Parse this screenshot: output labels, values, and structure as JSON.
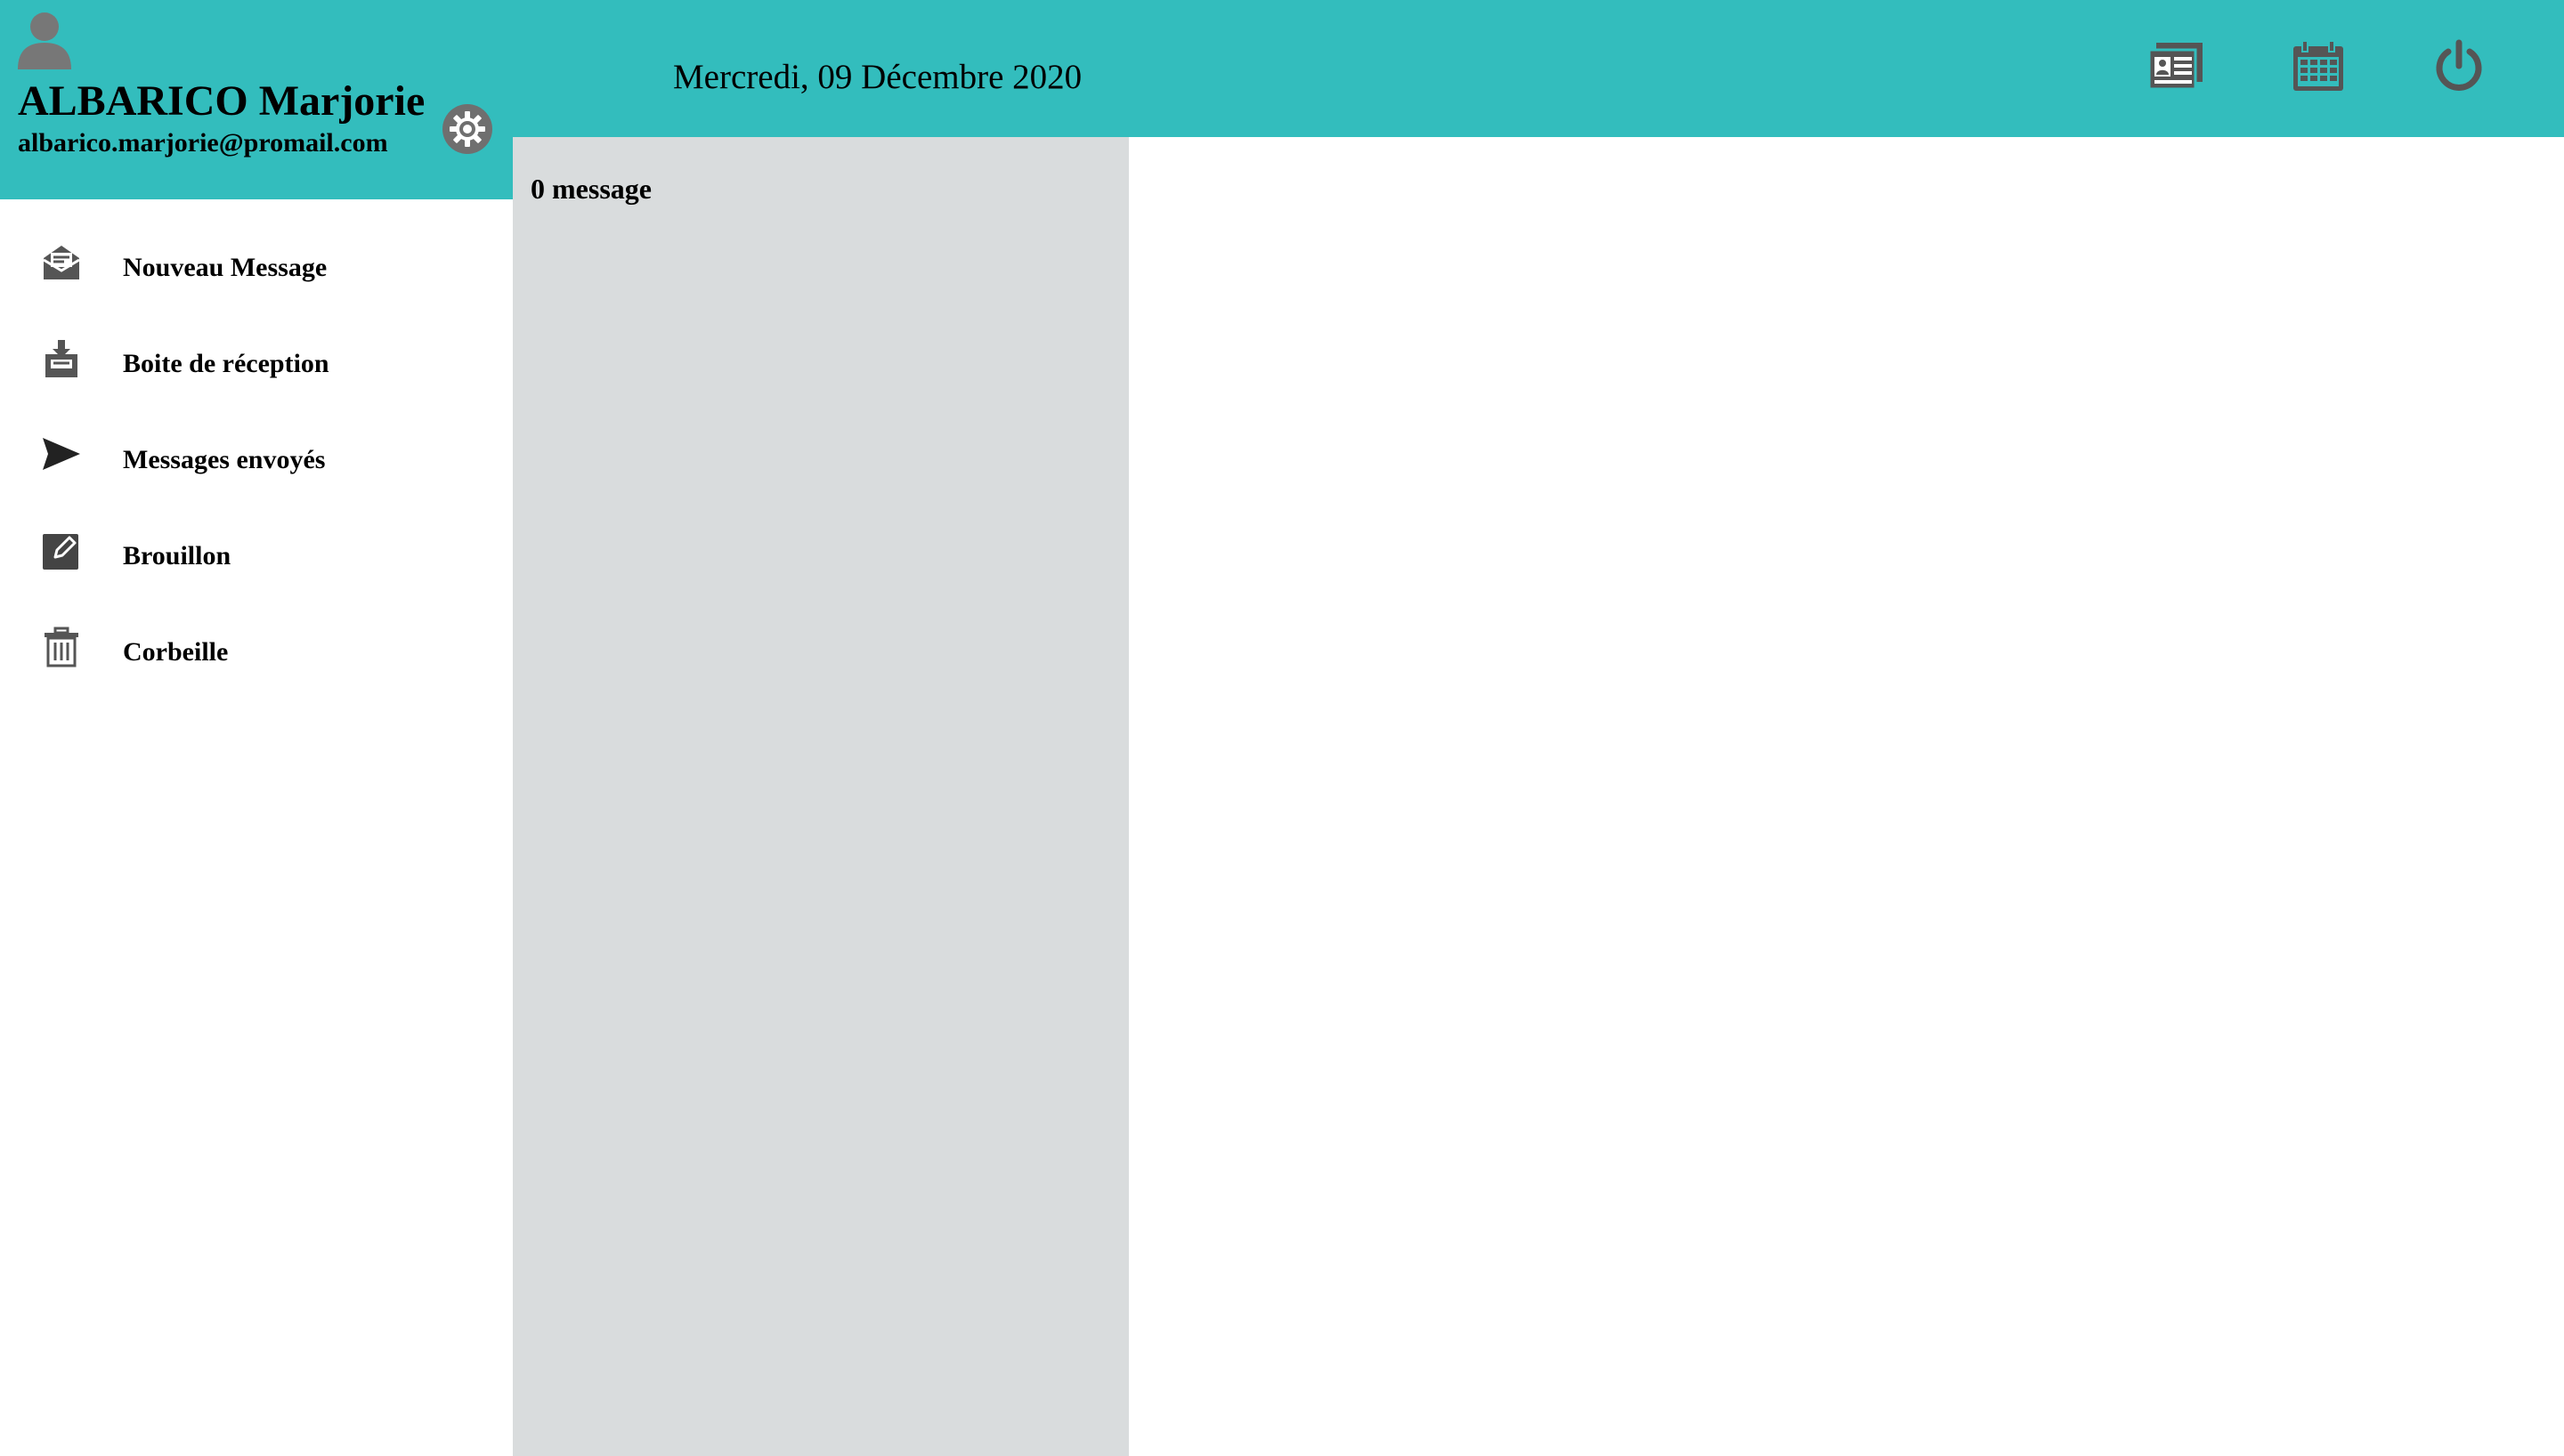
{
  "user": {
    "name": "ALBARICO Marjorie",
    "email": "albarico.marjorie@promail.com",
    "avatar_icon": "user-avatar-icon"
  },
  "header": {
    "date": "Mercredi, 09 Décembre 2020",
    "icons": [
      "contacts-card-icon",
      "calendar-icon",
      "power-icon"
    ]
  },
  "nav": {
    "items": [
      {
        "label": "Nouveau Message",
        "icon": "open-envelope-icon"
      },
      {
        "label": "Boite de réception",
        "icon": "inbox-tray-icon"
      },
      {
        "label": "Messages envoyés",
        "icon": "paper-plane-icon"
      },
      {
        "label": "Brouillon",
        "icon": "edit-square-icon"
      },
      {
        "label": "Corbeille",
        "icon": "trash-icon"
      }
    ]
  },
  "message_list": {
    "count_label": "0 message"
  },
  "colors": {
    "header_bg": "#33bdbd",
    "list_bg": "#d9dcdd",
    "icon_gray": "#555555"
  }
}
